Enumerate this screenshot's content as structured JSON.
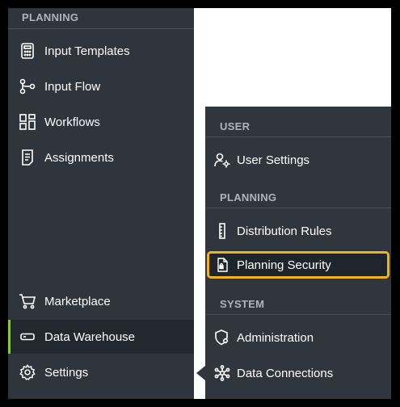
{
  "sidebar": {
    "section_label": "PLANNING",
    "items": [
      {
        "label": "Input Templates",
        "icon": "calculator-icon"
      },
      {
        "label": "Input Flow",
        "icon": "flow-icon"
      },
      {
        "label": "Workflows",
        "icon": "workflows-icon"
      },
      {
        "label": "Assignments",
        "icon": "assignments-icon"
      }
    ],
    "bottom_items": [
      {
        "label": "Marketplace",
        "icon": "cart-icon"
      },
      {
        "label": "Data Warehouse",
        "icon": "warehouse-icon",
        "active": true
      },
      {
        "label": "Settings",
        "icon": "gear-icon"
      }
    ]
  },
  "flyout": {
    "sections": [
      {
        "label": "USER",
        "items": [
          {
            "label": "User Settings",
            "icon": "user-settings-icon"
          }
        ]
      },
      {
        "label": "PLANNING",
        "items": [
          {
            "label": "Distribution Rules",
            "icon": "ruler-icon"
          },
          {
            "label": "Planning Security",
            "icon": "security-document-icon",
            "highlighted": true
          }
        ]
      },
      {
        "label": "SYSTEM",
        "items": [
          {
            "label": "Administration",
            "icon": "admin-shield-icon"
          },
          {
            "label": "Data Connections",
            "icon": "network-icon"
          }
        ]
      }
    ]
  },
  "colors": {
    "sidebar_bg": "#2f353d",
    "active_indicator": "#8cc63f",
    "highlight_border": "#f2b21e"
  }
}
